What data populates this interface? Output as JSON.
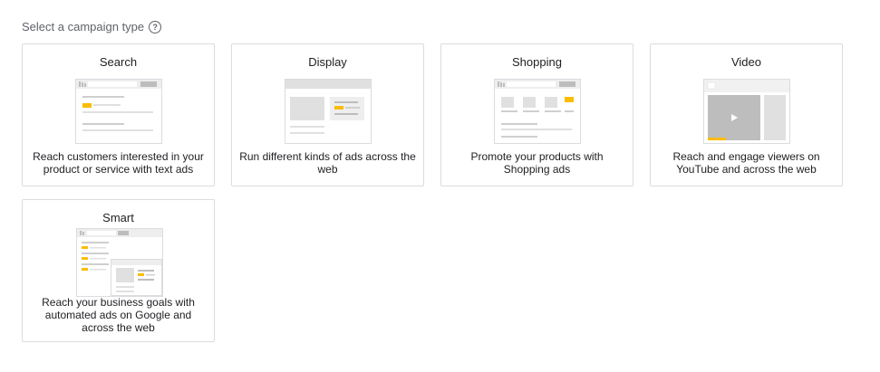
{
  "header": {
    "title": "Select a campaign type",
    "help_icon": "help-circle-icon",
    "help_glyph": "?"
  },
  "colors": {
    "accent": "#fbbc04",
    "mock_gray": "#e0e0e0",
    "border": "#dadce0"
  },
  "cards": [
    {
      "id": "search",
      "title": "Search",
      "description": "Reach customers interested in your product or service with text ads"
    },
    {
      "id": "display",
      "title": "Display",
      "description": "Run different kinds of ads across the web"
    },
    {
      "id": "shopping",
      "title": "Shopping",
      "description": "Promote your products with Shopping ads"
    },
    {
      "id": "video",
      "title": "Video",
      "description": "Reach and engage viewers on YouTube and across the web"
    },
    {
      "id": "smart",
      "title": "Smart",
      "description": "Reach your business goals with automated ads on Google and across the web"
    }
  ]
}
